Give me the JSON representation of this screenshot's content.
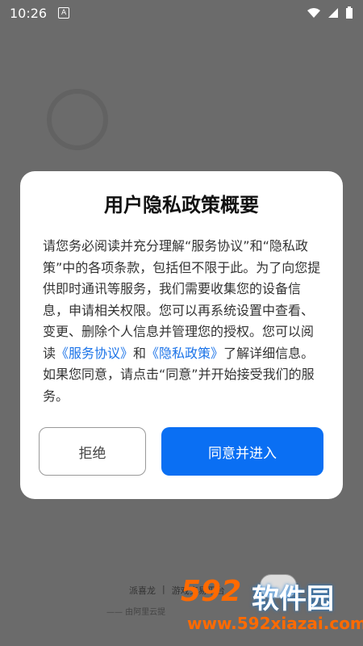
{
  "status": {
    "time": "10:26",
    "a_icon": "A"
  },
  "dialog": {
    "title": "用户隐私政策概要",
    "body_1": "请您务必阅读并充分理解“服务协议”和“隐私政策”中的各项条款，包括但不限于此。为了向您提供即时通讯等服务，我们需要收集您的设备信息，申请相关权限。您可以再系统设置中查看、变更、删除个人信息并管理您的授权。您可以阅读",
    "link_service": "《服务协议》",
    "body_and": "和",
    "link_privacy": "《隐私政策》",
    "body_2": "了解详细信息。如果您同意，请点击“同意”并开始接受我们的服务。",
    "decline_label": "拒绝",
    "accept_label": "同意并进入"
  },
  "background": {
    "brand_name": "派喜龙",
    "brand_slogan": "游戏交易平台",
    "brand_sub": "—— 由阿里云提"
  },
  "watermark": {
    "num": "592",
    "cn": "软件园",
    "url": "www.592xiazai.com"
  },
  "colors": {
    "accent": "#0a6ff3",
    "link": "#1b73e8",
    "overlay": "#6b6b6b"
  }
}
